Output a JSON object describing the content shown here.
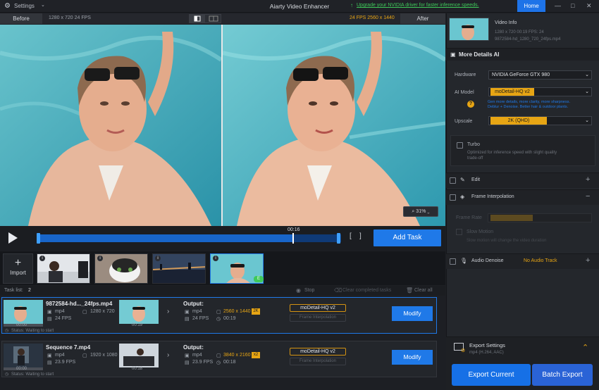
{
  "titlebar": {
    "settings": "Settings",
    "title": "Aiarty Video Enhancer",
    "upgrade": "Upgrade your NVIDIA driver for faster inference speeds.",
    "home": "Home"
  },
  "compare": {
    "before_label": "Before",
    "before_info": "1280 x 720  24 FPS",
    "after_info": "24 FPS  2560 x 1440",
    "after_label": "After"
  },
  "zoom": "31%",
  "playback": {
    "time": "00:16",
    "add_task": "Add Task",
    "progress_fraction": 0.84
  },
  "thumbs": {
    "import_label": "Import",
    "active_badge": "E"
  },
  "tasklist": {
    "label": "Task list:",
    "count": "2",
    "stop": "Stop",
    "clear_completed": "Clear completed tasks",
    "clear_all": "Clear all"
  },
  "tasks": [
    {
      "name": "9872584-hd..._24fps.mp4",
      "format": "mp4",
      "resolution": "1280 x 720",
      "fps": "24 FPS",
      "thumb_time": "00:00",
      "output_label": "Output:",
      "out_format": "mp4",
      "out_fps": "24 FPS",
      "out_res": "2560 x 1440",
      "out_tag": "2K",
      "duration": "00:19",
      "preview_time": "00:19",
      "model": "moDetail-HQ  v2",
      "frame_interp": "Frame Interpolation",
      "modify": "Modify",
      "status": "Status: Waiting to start"
    },
    {
      "name": "Sequence 7.mp4",
      "format": "mp4",
      "resolution": "1920 x 1080",
      "fps": "23.9 FPS",
      "thumb_time": "00:00",
      "output_label": "Output:",
      "out_format": "mp4",
      "out_fps": "23.9 FPS",
      "out_res": "3840 x 2160",
      "out_tag": "x2",
      "duration": "00:18",
      "preview_time": "00:18",
      "model": "moDetail-HQ  v2",
      "frame_interp": "Frame Interpolation",
      "modify": "Modify",
      "status": "Status: Waiting to start"
    }
  ],
  "right": {
    "video_info": {
      "title": "Video Info",
      "line1": "1280 x 720  00:19  FPS: 24",
      "line2": "9872584-hd_1280_720_24fps.mp4"
    },
    "more_details": "More Details AI",
    "hardware_label": "Hardware",
    "hardware_value": "NVIDIA GeForce GTX 980",
    "ai_model_label": "AI Model",
    "ai_model_value": "moDetail-HQ  v2",
    "model_desc1": "Gen more details, more clarity, more sharpness.",
    "model_desc2": "Deblur + Denoise. Better hair & outdoor plants.",
    "upscale_label": "Upscale",
    "upscale_value": "2K (QHD)",
    "turbo_label": "Turbo",
    "turbo_desc1": "Optimized for inference speed with slight quality",
    "turbo_desc2": "trade-off",
    "edit_label": "Edit",
    "frame_interp_label": "Frame Interpolation",
    "frame_rate_label": "Frame Rate",
    "slow_motion_label": "Slow Motion",
    "slow_motion_desc": "Slow motion will change the video duration",
    "audio_denoise_label": "Audio Denoise",
    "no_audio": "No Audio Track",
    "export_settings": "Export Settings",
    "export_sub": "mp4 (H.264, AAC)",
    "export_current": "Export Current",
    "batch_export": "Batch Export"
  },
  "colors": {
    "accent": "#1f79e8",
    "gold": "#e7a514",
    "green": "#3ec95a"
  }
}
